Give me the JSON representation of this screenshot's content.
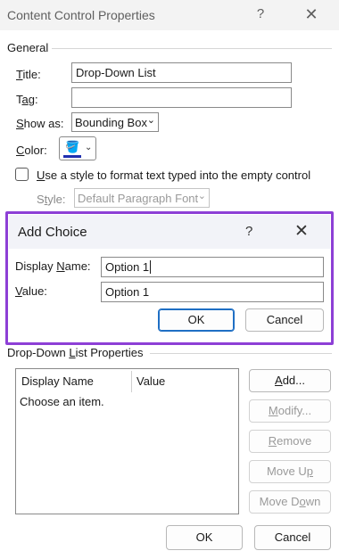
{
  "window": {
    "title": "Content Control Properties",
    "help_label": "?",
    "close_label": "✕"
  },
  "general": {
    "heading": "General",
    "title_label": "Title:",
    "title_value": "Drop-Down List",
    "tag_label": "Tag:",
    "tag_value": "",
    "show_as_label": "Show as:",
    "show_as_value": "Bounding Box",
    "color_label": "Color:",
    "color_swatch": "#1f2fb0",
    "style_checkbox_label": "Use a style to format text typed into the empty control",
    "style_label": "Style:",
    "style_value": "Default Paragraph Font"
  },
  "add_choice": {
    "title": "Add Choice",
    "help_label": "?",
    "close_label": "✕",
    "display_name_label": "Display Name:",
    "display_name_value": "Option 1",
    "value_label": "Value:",
    "value_value": "Option 1",
    "ok_label": "OK",
    "cancel_label": "Cancel",
    "highlight_color": "#8d3fd6"
  },
  "dropdown_props": {
    "heading": "Drop-Down List Properties",
    "columns": [
      "Display Name",
      "Value"
    ],
    "items": [
      "Choose an item."
    ],
    "buttons": {
      "add": "Add...",
      "modify": "Modify...",
      "remove": "Remove",
      "move_up": "Move Up",
      "move_down": "Move Down"
    }
  },
  "footer": {
    "ok_label": "OK",
    "cancel_label": "Cancel"
  }
}
